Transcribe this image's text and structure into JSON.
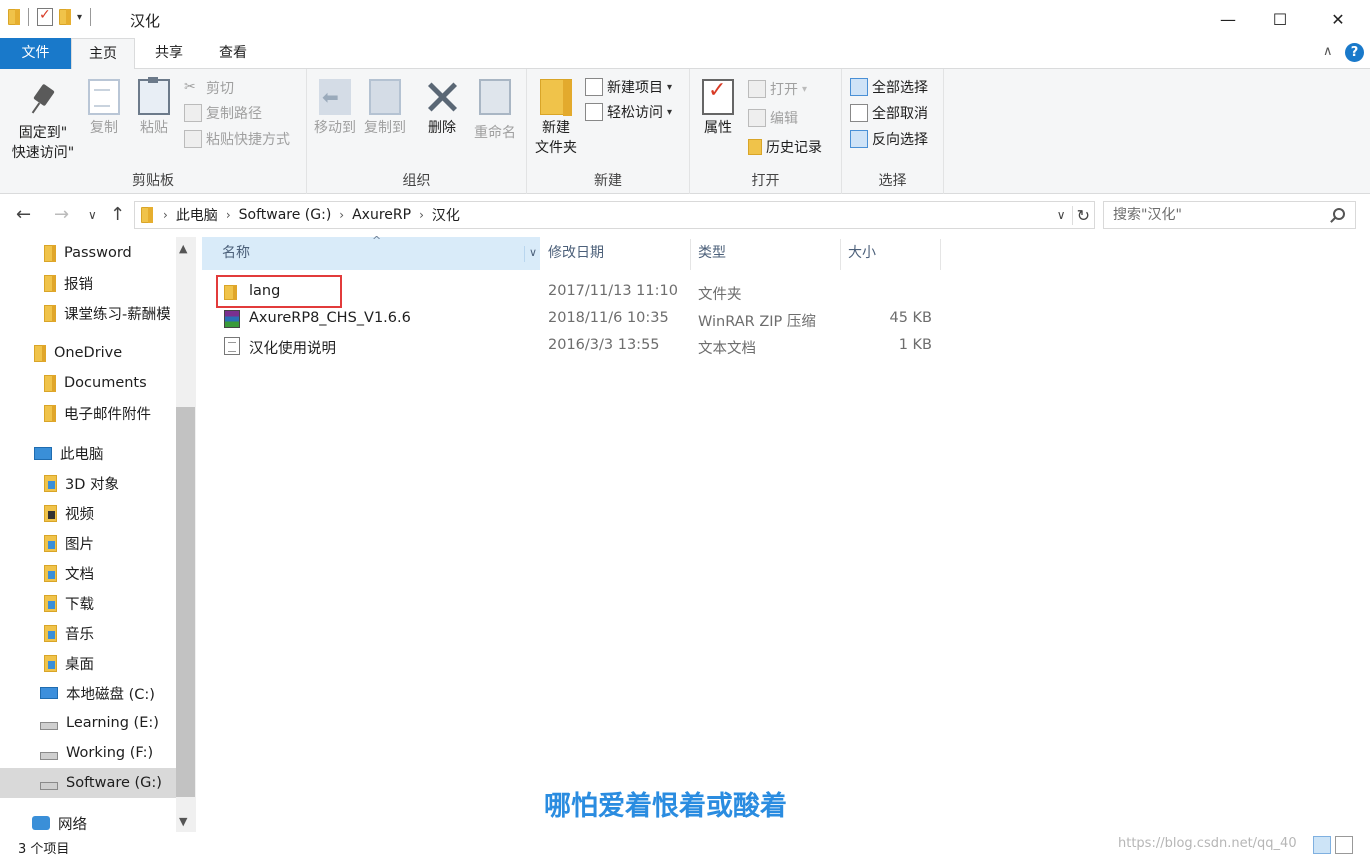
{
  "window": {
    "title": "汉化",
    "controls": {
      "minimize": "—",
      "maximize": "☐",
      "close": "✕"
    }
  },
  "ribbon_tabs": {
    "file": "文件",
    "home": "主页",
    "share": "共享",
    "view": "查看",
    "collapse": "∧",
    "help": "?"
  },
  "clipboard": {
    "pin_line1": "固定到\"",
    "pin_line2": "快速访问\"",
    "copy": "复制",
    "paste": "粘贴",
    "cut": "剪切",
    "copy_path": "复制路径",
    "paste_shortcut": "粘贴快捷方式",
    "label": "剪贴板"
  },
  "organize": {
    "move_to": "移动到",
    "copy_to": "复制到",
    "delete": "删除",
    "rename": "重命名",
    "label": "组织"
  },
  "new": {
    "new_folder_line1": "新建",
    "new_folder_line2": "文件夹",
    "new_item": "新建项目",
    "easy_access": "轻松访问",
    "label": "新建"
  },
  "open": {
    "properties": "属性",
    "open": "打开",
    "edit": "编辑",
    "history": "历史记录",
    "label": "打开"
  },
  "select": {
    "select_all": "全部选择",
    "select_none": "全部取消",
    "invert": "反向选择",
    "label": "选择"
  },
  "address": {
    "crumbs": [
      "此电脑",
      "Software (G:)",
      "AxureRP",
      "汉化"
    ]
  },
  "search": {
    "placeholder": "搜索\"汉化\""
  },
  "nav_pane": {
    "items": [
      "Password",
      "报销",
      "课堂练习-薪酬模",
      "OneDrive",
      "Documents",
      "电子邮件附件",
      "此电脑",
      "3D 对象",
      "视频",
      "图片",
      "文档",
      "下载",
      "音乐",
      "桌面",
      "本地磁盘 (C:)",
      "Learning (E:)",
      "Working (F:)",
      "Software (G:)",
      "网络"
    ],
    "selected": "Software (G:)"
  },
  "columns": {
    "name": "名称",
    "modified": "修改日期",
    "type": "类型",
    "size": "大小"
  },
  "files": [
    {
      "name": "lang",
      "modified": "2017/11/13 11:10",
      "type": "文件夹",
      "size": ""
    },
    {
      "name": "AxureRP8_CHS_V1.6.6",
      "modified": "2018/11/6 10:35",
      "type": "WinRAR ZIP 压缩",
      "size": "45 KB"
    },
    {
      "name": "汉化使用说明",
      "modified": "2016/3/3 13:55",
      "type": "文本文档",
      "size": "1 KB"
    }
  ],
  "status": {
    "count": "3 个项目"
  },
  "overlay": {
    "caption": "哪怕爱着恨着或酸着",
    "watermark": "https://blog.csdn.net/qq_40"
  },
  "colors": {
    "accent": "#1979ca",
    "highlight": "#d9ebf9",
    "annotation": "#e23b3b"
  }
}
